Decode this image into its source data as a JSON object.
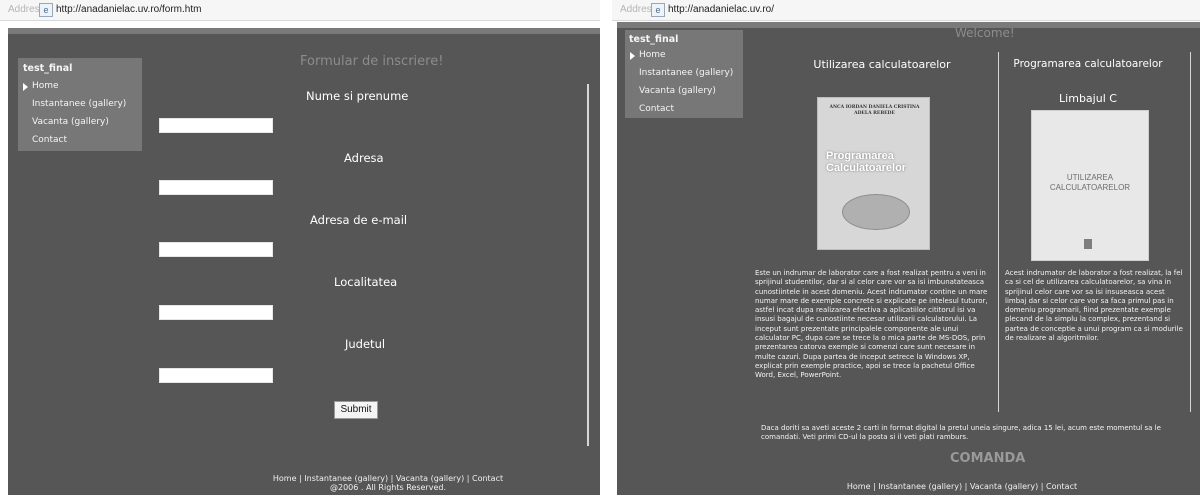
{
  "left": {
    "address_label": "Address",
    "url": "http://anadanielac.uv.ro/form.htm",
    "site_title": "test_final",
    "menu": [
      "Home",
      "Instantanee (gallery)",
      "Vacanta (gallery)",
      "Contact"
    ],
    "form_title": "Formular de inscriere!",
    "fields": [
      "Nume si prenume",
      "Adresa",
      "Adresa de e-mail",
      "Localitatea",
      "Judetul"
    ],
    "submit": "Submit",
    "footer_links": "Home | Instantanee (gallery) | Vacanta (gallery) | Contact",
    "footer_copy": "@2006 . All Rights Reserved."
  },
  "right": {
    "address_label": "Address",
    "url": "http://anadanielac.uv.ro/",
    "site_title": "test_final",
    "menu": [
      "Home",
      "Instantanee (gallery)",
      "Vacanta (gallery)",
      "Contact"
    ],
    "welcome": "Welcome!",
    "col1_title": "Utilizarea calculatoarelor",
    "col2_title": "Programarea calculatoarelor",
    "col2_subtitle": "Limbajul C",
    "book1": {
      "authors": "ANCA IORDAN DANIELA CRISTINA ADELA REBEDE",
      "title": "Programarea Calculatoarelor"
    },
    "book2": {
      "title": "UTILIZAREA CALCULATOARELOR"
    },
    "col1_text": "Este un indrumar de laborator care a fost realizat pentru a veni in sprijinul studentilor, dar si al celor care vor sa isi imbunatateasca cunostiintele in acest domeniu. Acest indrumator contine un mare numar mare de exemple concrete si explicate pe intelesul tuturor, astfel incat dupa realizarea efectiva a aplicatiilor cititorul isi va insusi bagajul de cunostiinte necesar utilizarii calculatorului. La inceput sunt prezentate principalele componente ale unui calculator PC, dupa care se trece la o mica parte de MS-DOS, prin prezentarea catorva exemple si comenzi care sunt necesare in multe cazuri. Dupa partea de inceput setrece la Windows XP, explicat prin exemple practice, apoi se trece la pachetul Office Word, Excel, PowerPoint.",
    "col2_text": "Acest indrumator de laborator a fost realizat, la fel ca si cel de utilizarea calculatoarelor, sa vina in sprijinul celor care vor sa isi insuseasca acest limbaj dar si celor care vor sa faca primul pas in domeniu programarii, fiind prezentate exemple plecand de la simplu la complex, prezentand si partea de conceptie a unui program ca si modurile de realizare al algoritmilor.",
    "order_text": "Daca doriti sa aveti aceste 2 carti in format digital la pretul uneia singure, adica 15 lei, acum este momentul sa le comandati. Veti primi CD-ul la posta si il veti plati ramburs.",
    "order_button": "COMANDA",
    "footer_links": "Home | Instantanee (gallery) | Vacanta (gallery) | Contact"
  }
}
